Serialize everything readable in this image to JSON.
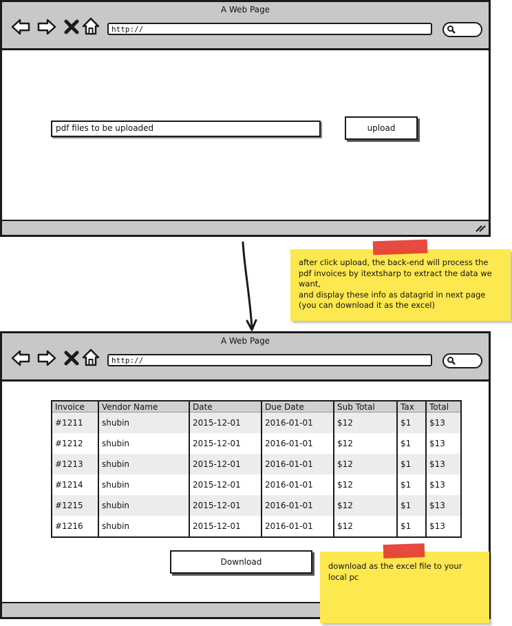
{
  "window1": {
    "title": "A Web Page",
    "url": "http://",
    "file_field_value": "pdf files to be uploaded",
    "upload_label": "upload"
  },
  "note1": {
    "lines": [
      "after click upload, the back-end will process the",
      "pdf invoices by itextsharp to extract the data we",
      "want,",
      "and display these info as datagrid in next page",
      "(you can download it as the excel)"
    ]
  },
  "window2": {
    "title": "A Web Page",
    "url": "http://",
    "table": {
      "headers": [
        "Invoice",
        "Vendor Name",
        "Date",
        "Due Date",
        "Sub Total",
        "Tax",
        "Total"
      ],
      "rows": [
        [
          "#1211",
          "shubin",
          "2015-12-01",
          "2016-01-01",
          "$12",
          "$1",
          "$13"
        ],
        [
          "#1212",
          "shubin",
          "2015-12-01",
          "2016-01-01",
          "$12",
          "$1",
          "$13"
        ],
        [
          "#1213",
          "shubin",
          "2015-12-01",
          "2016-01-01",
          "$12",
          "$1",
          "$13"
        ],
        [
          "#1214",
          "shubin",
          "2015-12-01",
          "2016-01-01",
          "$12",
          "$1",
          "$13"
        ],
        [
          "#1215",
          "shubin",
          "2015-12-01",
          "2016-01-01",
          "$12",
          "$1",
          "$13"
        ],
        [
          "#1216",
          "shubin",
          "2015-12-01",
          "2016-01-01",
          "$12",
          "$1",
          "$13"
        ]
      ]
    },
    "download_label": "Download"
  },
  "note2": {
    "lines": [
      "download as the excel file to your",
      "local pc"
    ]
  },
  "colors": {
    "note": "#fde84f",
    "tape": "#e53b31",
    "chrome": "#c8c8c8"
  }
}
